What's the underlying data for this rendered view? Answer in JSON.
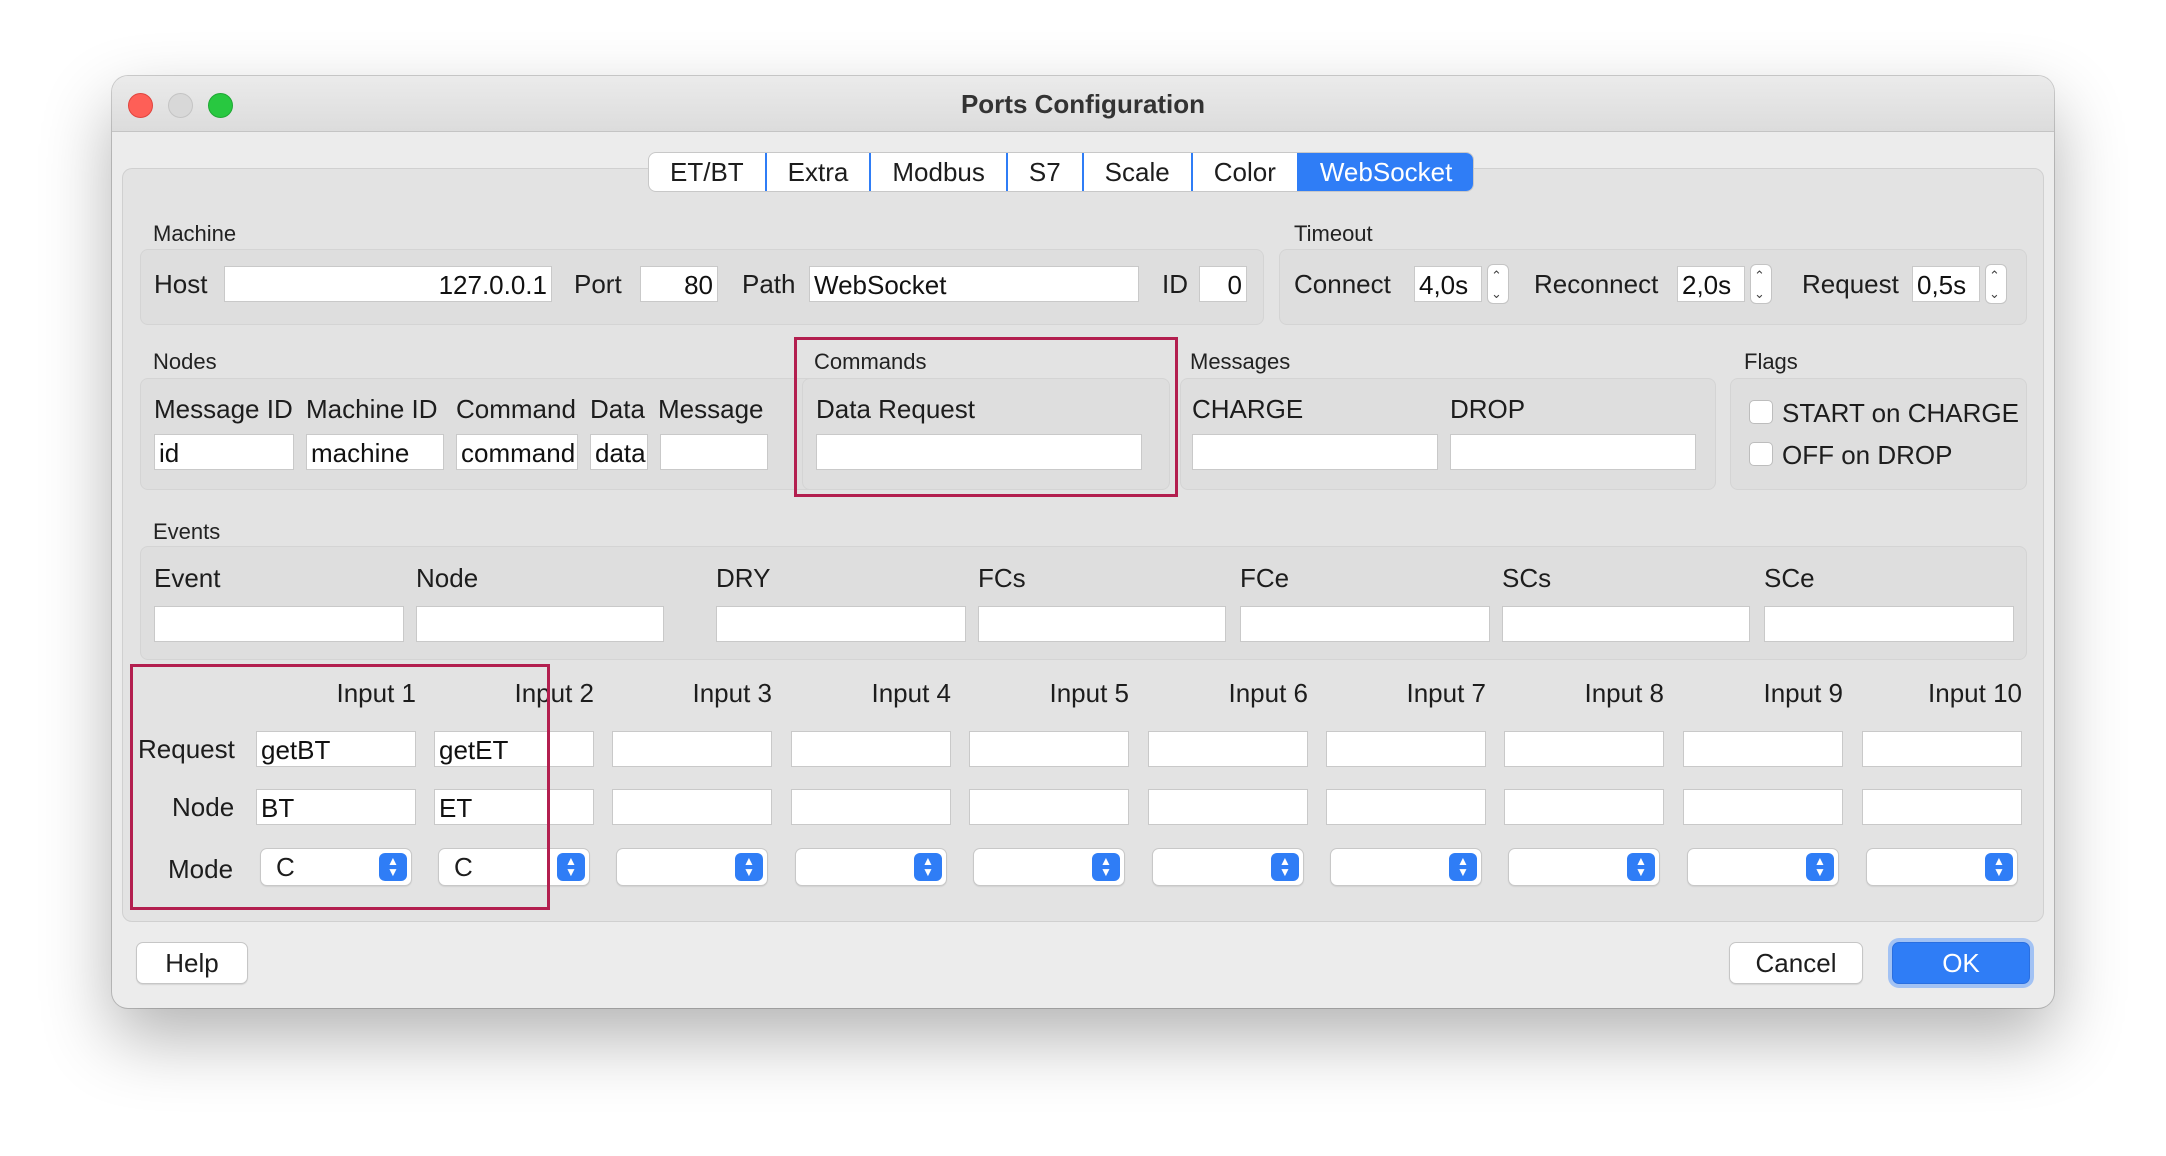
{
  "window": {
    "title": "Ports Configuration"
  },
  "tabs": [
    "ET/BT",
    "Extra",
    "Modbus",
    "S7",
    "Scale",
    "Color",
    "WebSocket"
  ],
  "active_tab": "WebSocket",
  "machine": {
    "group_label": "Machine",
    "host_label": "Host",
    "host_value": "127.0.0.1",
    "port_label": "Port",
    "port_value": "80",
    "path_label": "Path",
    "path_value": "WebSocket",
    "id_label": "ID",
    "id_value": "0"
  },
  "timeout": {
    "group_label": "Timeout",
    "connect_label": "Connect",
    "connect_value": "4,0s",
    "reconnect_label": "Reconnect",
    "reconnect_value": "2,0s",
    "request_label": "Request",
    "request_value": "0,5s"
  },
  "nodes": {
    "group_label": "Nodes",
    "headers": [
      "Message ID",
      "Machine ID",
      "Command",
      "Data",
      "Message"
    ],
    "values": [
      "id",
      "machine",
      "command",
      "data",
      ""
    ]
  },
  "commands": {
    "group_label": "Commands",
    "data_request_label": "Data Request",
    "data_request_value": ""
  },
  "messages": {
    "group_label": "Messages",
    "charge_label": "CHARGE",
    "drop_label": "DROP"
  },
  "flags": {
    "group_label": "Flags",
    "start_on_charge": "START on CHARGE",
    "off_on_drop": "OFF on DROP"
  },
  "events": {
    "group_label": "Events",
    "headers": [
      "Event",
      "Node",
      "DRY",
      "FCs",
      "FCe",
      "SCs",
      "SCe"
    ]
  },
  "inputs": {
    "row_labels": {
      "request": "Request",
      "node": "Node",
      "mode": "Mode"
    },
    "columns": [
      {
        "label": "Input 1",
        "request": "getBT",
        "node": "BT",
        "mode": "C"
      },
      {
        "label": "Input 2",
        "request": "getET",
        "node": "ET",
        "mode": "C"
      },
      {
        "label": "Input 3",
        "request": "",
        "node": "",
        "mode": ""
      },
      {
        "label": "Input 4",
        "request": "",
        "node": "",
        "mode": ""
      },
      {
        "label": "Input 5",
        "request": "",
        "node": "",
        "mode": ""
      },
      {
        "label": "Input 6",
        "request": "",
        "node": "",
        "mode": ""
      },
      {
        "label": "Input 7",
        "request": "",
        "node": "",
        "mode": ""
      },
      {
        "label": "Input 8",
        "request": "",
        "node": "",
        "mode": ""
      },
      {
        "label": "Input 9",
        "request": "",
        "node": "",
        "mode": ""
      },
      {
        "label": "Input 10",
        "request": "",
        "node": "",
        "mode": ""
      }
    ]
  },
  "buttons": {
    "help": "Help",
    "cancel": "Cancel",
    "ok": "OK"
  },
  "colors": {
    "accent": "#2f7df6",
    "highlight": "#b31f4f"
  }
}
